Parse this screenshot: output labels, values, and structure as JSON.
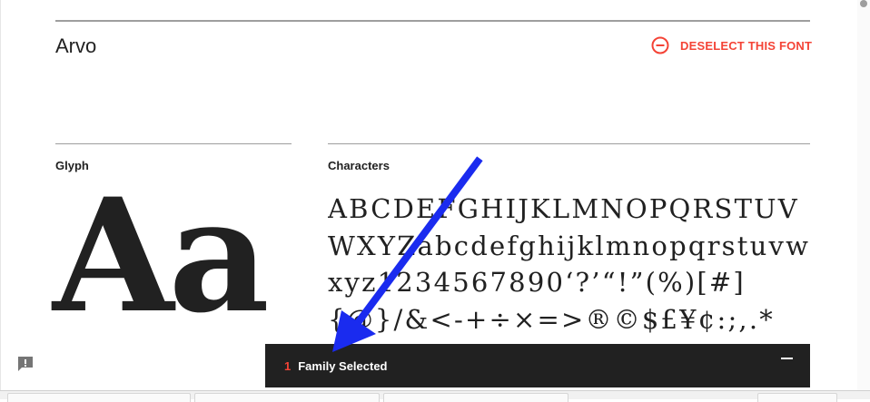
{
  "font": {
    "name": "Arvo",
    "deselect_label": "DESELECT THIS FONT"
  },
  "glyph": {
    "label": "Glyph",
    "sample": "Aa"
  },
  "characters": {
    "label": "Characters",
    "sample": "ABCDEFGHIJKLMNOPQRSTUVWXYZabcdefghijklmnopqrstuvwxyz1234567890‘?’“!”(%)[#]{@}/&<-+÷×=>®©$£¥¢:;,.*"
  },
  "drawer": {
    "count": "1",
    "label": "Family Selected"
  },
  "icons": {
    "deselect": "minus-circle-icon",
    "feedback": "feedback-icon",
    "collapse": "minus-icon"
  },
  "colors": {
    "accent": "#f44336",
    "drawer_bg": "#212121",
    "annotation_arrow": "#1a2bef"
  }
}
